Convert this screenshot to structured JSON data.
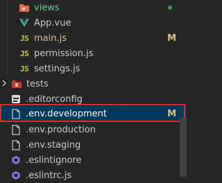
{
  "items": [
    {
      "label": "views",
      "badge": "",
      "status": "dot",
      "color": "#73c991"
    },
    {
      "label": "App.vue",
      "badge": "",
      "color": "#cccccc"
    },
    {
      "label": "main.js",
      "badge": "M",
      "color": "#e2c08d"
    },
    {
      "label": "permission.js",
      "badge": "",
      "color": "#cccccc"
    },
    {
      "label": "settings.js",
      "badge": "",
      "color": "#cccccc"
    },
    {
      "label": "tests",
      "badge": "",
      "color": "#cccccc"
    },
    {
      "label": ".editorconfig",
      "badge": "",
      "color": "#cccccc"
    },
    {
      "label": ".env.development",
      "badge": "M",
      "color": "#e2c08d"
    },
    {
      "label": ".env.production",
      "badge": "",
      "color": "#cccccc"
    },
    {
      "label": ".env.staging",
      "badge": "",
      "color": "#cccccc"
    },
    {
      "label": ".eslintignore",
      "badge": "",
      "color": "#cccccc"
    },
    {
      "label": ".eslintrc.js",
      "badge": "",
      "color": "#cccccc"
    }
  ],
  "icons": {
    "js_text": "JS"
  }
}
